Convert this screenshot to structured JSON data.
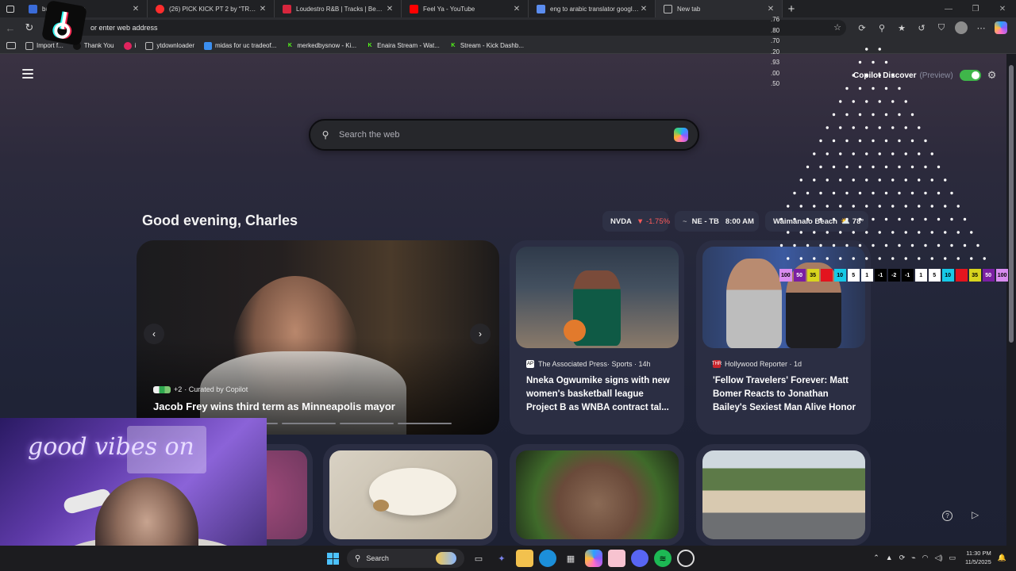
{
  "tabs": [
    {
      "title": "bandlab search",
      "favicon_color": "#3a6bd8",
      "active": false
    },
    {
      "title": "(26) PICK KICK PT 2 by “TRELLZ”",
      "favicon_color": "#ff2d2d",
      "active": false
    },
    {
      "title": "Loudestro R&B | Tracks | BeatStars",
      "favicon_color": "#d7263d",
      "active": false
    },
    {
      "title": "Feel Ya - YouTube",
      "favicon_color": "#ff0000",
      "active": false
    },
    {
      "title": "eng to arabic translator google -",
      "favicon_color": "#5b8def",
      "active": false
    },
    {
      "title": "New tab",
      "favicon_color": "#8a8a8a",
      "active": true
    }
  ],
  "address_bar": {
    "placeholder": "or enter web address"
  },
  "bookmarks": [
    {
      "label": "Import f...",
      "color": "#3a3b3f"
    },
    {
      "label": "Thank You",
      "color": "#111111"
    },
    {
      "label": "i",
      "color": "#e0245e"
    },
    {
      "label": "ytdownloader",
      "color": "#3a3b3f"
    },
    {
      "label": "midas for uc tradeof...",
      "color": "#3b8ff0"
    },
    {
      "label": "merkedbysnow - Ki...",
      "color": "#53fc18"
    },
    {
      "label": "Enaira Stream - Wat...",
      "color": "#53fc18"
    },
    {
      "label": "Stream - Kick Dashb...",
      "color": "#53fc18"
    }
  ],
  "discover": {
    "label": "Copilot Discover",
    "preview": "(Preview)",
    "enabled": true
  },
  "search": {
    "placeholder": "Search the web"
  },
  "greeting": "Good evening, Charles",
  "chips": {
    "stock": {
      "symbol": "NVDA",
      "change": "▼ -1.75%"
    },
    "sports": {
      "prefix": "~",
      "teams": "NE - TB",
      "time": "8:00 AM"
    },
    "weather": {
      "location": "Waimanalo Beach",
      "icon": "⛅",
      "temp": "78°"
    }
  },
  "hero": {
    "sources_extra": "+2",
    "curated": "· Curated by Copilot",
    "title": "Jacob Frey wins third term as Minneapolis mayor"
  },
  "cards": [
    {
      "source": "The Associated Press· Sports · 14h",
      "headline": "Nneka Ogwumike signs with new women's basketball league Project B as WNBA contract tal...",
      "image_desc": "basketball"
    },
    {
      "source": "Hollywood Reporter · 1d",
      "headline": "'Fellow Travelers' Forever: Matt Bomer Reacts to Jonathan Bailey's Sexiest Man Alive Honor",
      "image_desc": "two men"
    }
  ],
  "scoreboard": [
    "100",
    "50",
    "35",
    "",
    "10",
    "5",
    "1",
    "-1",
    "-2",
    "-1",
    "1",
    "5",
    "10",
    "",
    "35",
    "50",
    "100"
  ],
  "side_numbers": [
    ".76",
    ".80",
    ".70",
    ".20",
    ".93",
    ".00",
    ".50"
  ],
  "webcam_text": "good vibes on",
  "taskbar": {
    "search_label": "Search",
    "time": "11:30 PM",
    "date": "11/5/2025"
  }
}
